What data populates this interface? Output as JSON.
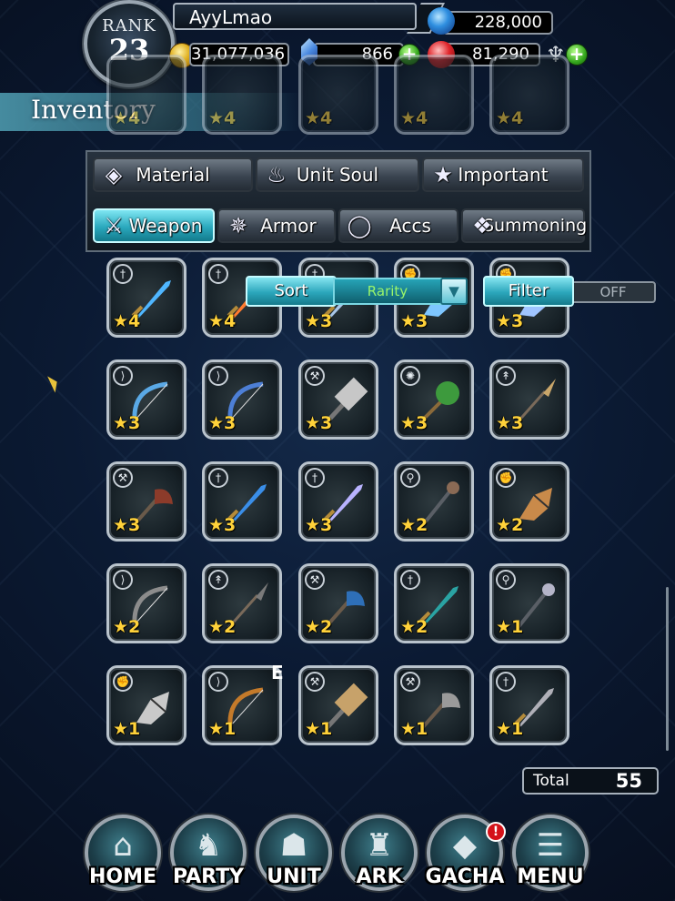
{
  "header": {
    "rank_label": "RANK",
    "rank_value": "23",
    "player_name": "AyyLmao",
    "blue_orbs": "228,000",
    "gil": "31,077,036",
    "gems": "866",
    "red_orbs": "81,290"
  },
  "page": {
    "title": "Inventory"
  },
  "tabs": {
    "row1": [
      {
        "label": "Material",
        "icon": "bag-icon"
      },
      {
        "label": "Unit Soul",
        "icon": "soul-flame-icon"
      },
      {
        "label": "Important",
        "icon": "star-icon"
      }
    ],
    "row2": [
      {
        "label": "Weapon",
        "icon": "sword-icon",
        "active": true
      },
      {
        "label": "Armor",
        "icon": "armor-icon"
      },
      {
        "label": "Accs",
        "icon": "ring-icon"
      },
      {
        "label": "Summoning",
        "icon": "summon-crystal-icon"
      }
    ]
  },
  "sort": {
    "label": "Sort",
    "value": "Rarity"
  },
  "filter": {
    "label": "Filter",
    "value": "OFF"
  },
  "background_items_rarity": [
    "4",
    "4",
    "4",
    "4",
    "4"
  ],
  "items": [
    {
      "type": "sword",
      "rarity": "4"
    },
    {
      "type": "sword",
      "rarity": "4"
    },
    {
      "type": "greatsword",
      "rarity": "3"
    },
    {
      "type": "fist",
      "rarity": "3"
    },
    {
      "type": "fist",
      "rarity": "3"
    },
    {
      "type": "bow",
      "rarity": "3"
    },
    {
      "type": "bow",
      "rarity": "3"
    },
    {
      "type": "hammer",
      "rarity": "3"
    },
    {
      "type": "mace",
      "rarity": "3"
    },
    {
      "type": "spear",
      "rarity": "3"
    },
    {
      "type": "axe",
      "rarity": "3"
    },
    {
      "type": "sword",
      "rarity": "3"
    },
    {
      "type": "sword",
      "rarity": "3"
    },
    {
      "type": "staff",
      "rarity": "2"
    },
    {
      "type": "fist",
      "rarity": "2"
    },
    {
      "type": "bow",
      "rarity": "2"
    },
    {
      "type": "spear",
      "rarity": "2"
    },
    {
      "type": "axe",
      "rarity": "2"
    },
    {
      "type": "sword",
      "rarity": "2"
    },
    {
      "type": "staff",
      "rarity": "1"
    },
    {
      "type": "fist",
      "rarity": "1"
    },
    {
      "type": "bow",
      "rarity": "1"
    },
    {
      "type": "hammer",
      "rarity": "1"
    },
    {
      "type": "axe",
      "rarity": "1"
    },
    {
      "type": "sword",
      "rarity": "1"
    }
  ],
  "equipped_marker": "E",
  "total": {
    "label": "Total",
    "value": "55"
  },
  "nav": [
    {
      "label": "HOME",
      "icon": "home-icon"
    },
    {
      "label": "PARTY",
      "icon": "party-icon"
    },
    {
      "label": "UNIT",
      "icon": "unit-icon"
    },
    {
      "label": "ARK",
      "icon": "ark-icon"
    },
    {
      "label": "GACHA",
      "icon": "gacha-icon",
      "badge": "!"
    },
    {
      "label": "MENU",
      "icon": "menu-scroll-icon"
    }
  ],
  "colors": {
    "accent": "#2aa8bd",
    "star": "#ffd23a",
    "plus": "#33a61c",
    "notification": "#d4121a"
  }
}
